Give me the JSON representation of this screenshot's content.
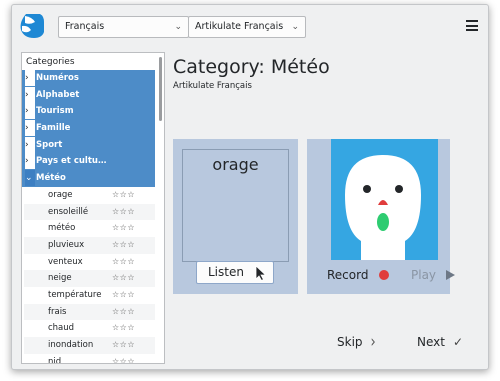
{
  "toolbar": {
    "language": "Français",
    "voice": "Artikulate Français",
    "chevron": "⌄"
  },
  "sidebar": {
    "header": "Categories",
    "categories": [
      {
        "label": "Numéros",
        "arrow": "›"
      },
      {
        "label": "Alphabet",
        "arrow": "›"
      },
      {
        "label": "Tourism",
        "arrow": "›"
      },
      {
        "label": "Famille",
        "arrow": "›"
      },
      {
        "label": "Sport",
        "arrow": "›"
      },
      {
        "label": "Pays et cultu…",
        "arrow": "›"
      },
      {
        "label": "Météo",
        "arrow": "⌄"
      }
    ],
    "items": [
      {
        "label": "orage",
        "stars": "☆☆☆"
      },
      {
        "label": "ensoleillé",
        "stars": "☆☆☆"
      },
      {
        "label": "météo",
        "stars": "☆☆☆"
      },
      {
        "label": "pluvieux",
        "stars": "☆☆☆"
      },
      {
        "label": "venteux",
        "stars": "☆☆☆"
      },
      {
        "label": "neige",
        "stars": "☆☆☆"
      },
      {
        "label": "température",
        "stars": "☆☆☆"
      },
      {
        "label": "frais",
        "stars": "☆☆☆"
      },
      {
        "label": "chaud",
        "stars": "☆☆☆"
      },
      {
        "label": "inondation",
        "stars": "☆☆☆"
      },
      {
        "label": "nid",
        "stars": "☆☆☆"
      }
    ]
  },
  "main": {
    "title": "Category: Météo",
    "subtitle": "Artikulate Français",
    "word": "orage",
    "listen_label": "Listen",
    "record_label": "Record",
    "play_label": "Play",
    "skip_label": "Skip",
    "skip_glyph": "›",
    "next_label": "Next",
    "next_glyph": "✓"
  },
  "colors": {
    "selection": "#4d8cc8",
    "card_bg": "#b8c8de",
    "face_bg": "#35a6e2",
    "record_dot": "#e03c3c"
  },
  "icons": [
    "app-logo-icon",
    "hamburger-menu-icon",
    "chevron-down-icon",
    "expand-arrow-icon",
    "star-icon",
    "cursor-icon",
    "record-icon",
    "play-icon",
    "chevron-right-icon",
    "checkmark-icon"
  ]
}
